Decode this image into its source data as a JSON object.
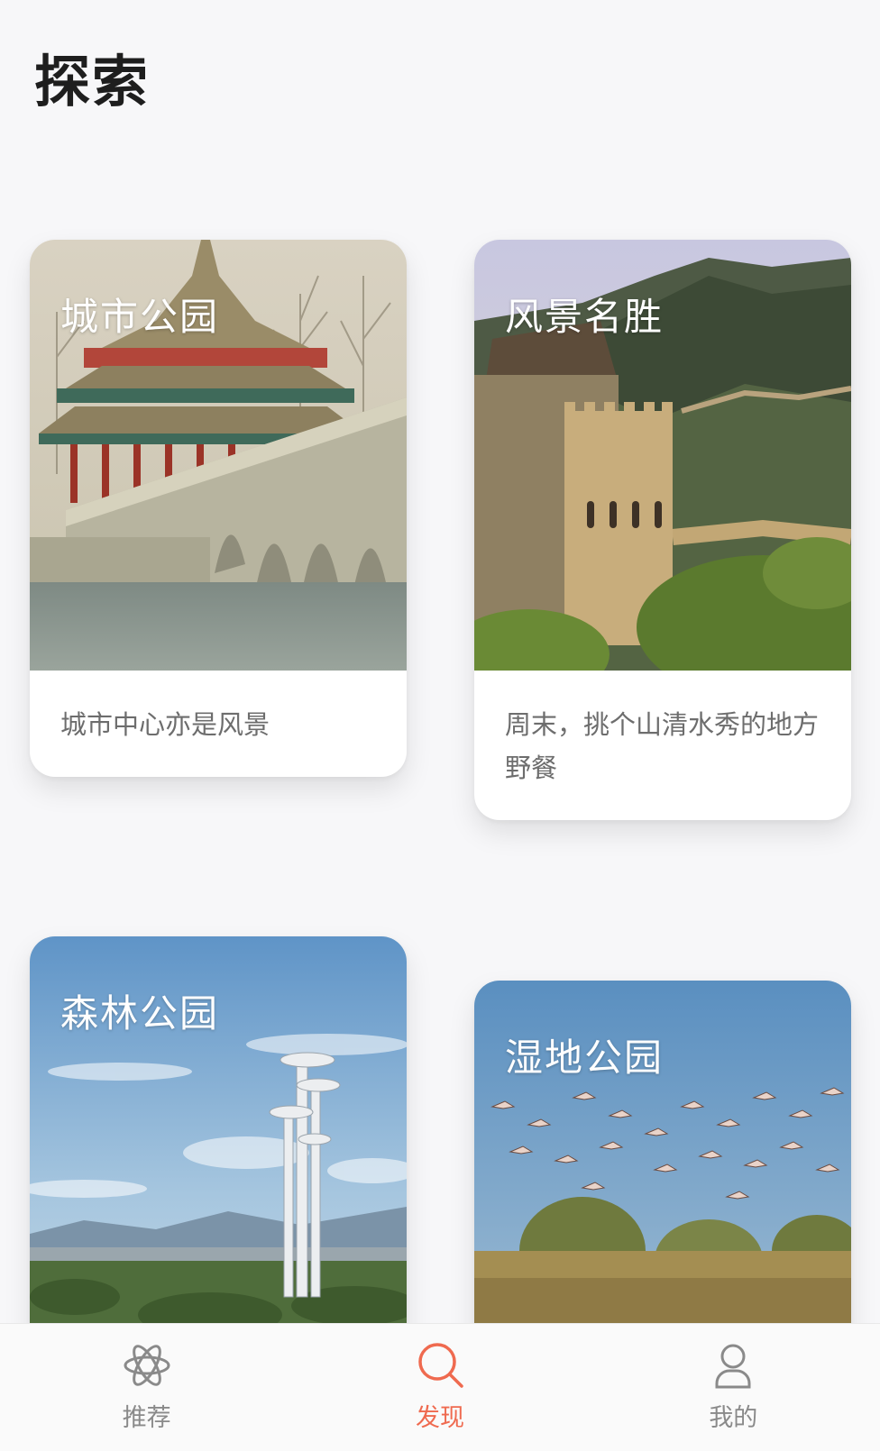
{
  "header": {
    "title": "探索"
  },
  "cards": [
    {
      "title": "城市公园",
      "description": "城市中心亦是风景"
    },
    {
      "title": "风景名胜",
      "description": "周末，挑个山清水秀的地方野餐"
    },
    {
      "title": "森林公园",
      "description": ""
    },
    {
      "title": "湿地公园",
      "description": ""
    }
  ],
  "tabbar": {
    "items": [
      {
        "label": "推荐",
        "icon": "atom-icon",
        "active": false
      },
      {
        "label": "发现",
        "icon": "search-icon",
        "active": true
      },
      {
        "label": "我的",
        "icon": "person-icon",
        "active": false
      }
    ],
    "active_color": "#ef6a4f",
    "inactive_color": "#8a8a8a"
  }
}
